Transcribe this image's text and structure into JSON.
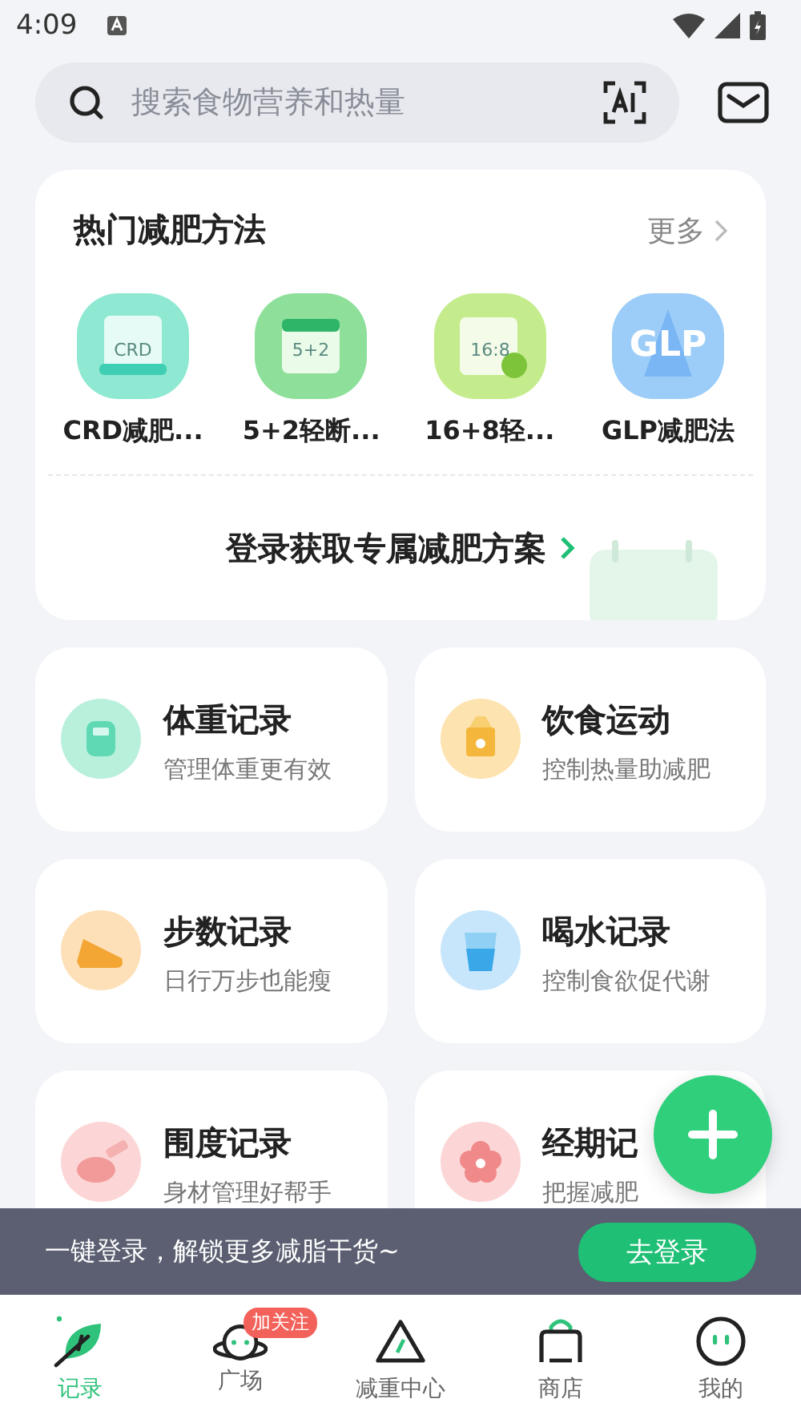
{
  "status_bar": {
    "time": "4:09"
  },
  "search": {
    "placeholder": "搜索食物营养和热量"
  },
  "methods_card": {
    "title": "热门减肥方法",
    "more": "更多",
    "methods": [
      {
        "label": "CRD减肥...",
        "kind": "crd",
        "icon_text": "CRD",
        "color": "#8fe8d2"
      },
      {
        "label": "5+2轻断...",
        "kind": "calendar",
        "icon_text": "5+2",
        "color": "#8ddf9a"
      },
      {
        "label": "16+8轻...",
        "kind": "clock",
        "icon_text": "16:8",
        "color": "#c4ec8c"
      },
      {
        "label": "GLP减肥法",
        "kind": "glp",
        "icon_text": "GLP",
        "color": "#9ccdf8"
      }
    ],
    "login_prompt": "登录获取专属减肥方案"
  },
  "records": [
    {
      "title": "体重记录",
      "subtitle": "管理体重更有效",
      "kind": "scale",
      "color": "#b9f0dc"
    },
    {
      "title": "饮食运动",
      "subtitle": "控制热量助减肥",
      "kind": "food",
      "color": "#fde3b0"
    },
    {
      "title": "步数记录",
      "subtitle": "日行万步也能瘦",
      "kind": "shoe",
      "color": "#fde0b8"
    },
    {
      "title": "喝水记录",
      "subtitle": "控制食欲促代谢",
      "kind": "water",
      "color": "#c7e6fb"
    },
    {
      "title": "围度记录",
      "subtitle": "身材管理好帮手",
      "kind": "tape",
      "color": "#fcd6d6"
    },
    {
      "title": "经期记",
      "subtitle": "把握减肥",
      "kind": "flower",
      "color": "#fcd6d6"
    }
  ],
  "login_banner": {
    "text": "一键登录，解锁更多减脂干货~",
    "button": "去登录"
  },
  "tabs": [
    {
      "label": "记录",
      "kind": "leaf",
      "selected": true
    },
    {
      "label": "广场",
      "kind": "planet",
      "selected": false,
      "badge": "加关注"
    },
    {
      "label": "减重中心",
      "kind": "triangle",
      "selected": false
    },
    {
      "label": "商店",
      "kind": "bag",
      "selected": false
    },
    {
      "label": "我的",
      "kind": "face",
      "selected": false
    }
  ]
}
